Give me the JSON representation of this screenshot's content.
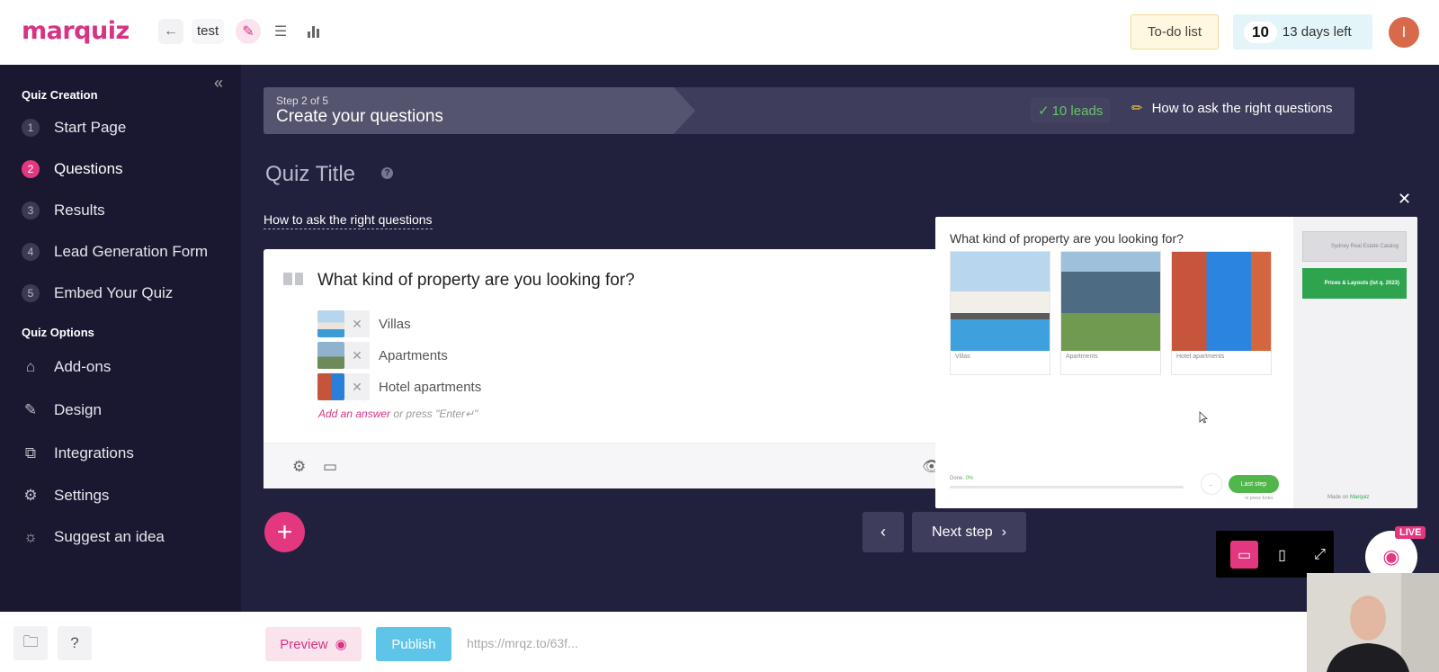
{
  "header": {
    "logo": "marquiz",
    "quiz_name": "test",
    "todo_label": "To-do list",
    "days_count": "10",
    "days_label": "13 days left",
    "avatar_initial": "I"
  },
  "sidebar": {
    "section_creation": "Quiz Creation",
    "steps": [
      {
        "num": "1",
        "label": "Start Page"
      },
      {
        "num": "2",
        "label": "Questions"
      },
      {
        "num": "3",
        "label": "Results"
      },
      {
        "num": "4",
        "label": "Lead Generation Form"
      },
      {
        "num": "5",
        "label": "Embed Your Quiz"
      }
    ],
    "section_options": "Quiz Options",
    "options": [
      {
        "label": "Add-ons",
        "icon": "tag-icon"
      },
      {
        "label": "Design",
        "icon": "brush-icon"
      },
      {
        "label": "Integrations",
        "icon": "plug-icon"
      },
      {
        "label": "Settings",
        "icon": "gear-icon"
      },
      {
        "label": "Suggest an idea",
        "icon": "lightbulb-icon"
      }
    ]
  },
  "stepbar": {
    "step_small": "Step 2 of 5",
    "step_title": "Create your questions",
    "leads": "10 leads",
    "howto": "How to ask the right questions"
  },
  "main": {
    "quiz_title": "Quiz Title",
    "howto_link": "How to ask the right questions",
    "question": "What kind of property are you looking for?",
    "answers": [
      {
        "label": "Villas"
      },
      {
        "label": "Apartments"
      },
      {
        "label": "Hotel apartments"
      }
    ],
    "add_answer_link": "Add an answer",
    "add_answer_hint": " or press \"Enter↵\"",
    "next_step": "Next step"
  },
  "preview": {
    "question": "What kind of property are you looking for?",
    "cards": [
      "Villas",
      "Apartments",
      "Hotel apartments"
    ],
    "done_label": "Done:",
    "done_value": "0%",
    "progress": 0,
    "last_step": "Last step",
    "enter_hint": "or press Enter",
    "side_item1": "Sydney Real Estate Catalog",
    "side_item2": "Prices & Layouts (Ist q. 2023)",
    "made_on": "Made on",
    "made_brand": "Marquiz",
    "live_badge": "LIVE"
  },
  "bottombar": {
    "preview_label": "Preview",
    "publish_label": "Publish",
    "url": "https://mrqz.to/63f..."
  },
  "colors": {
    "accent": "#e3387f",
    "sidebar_bg": "#191830",
    "main_bg": "#22213d",
    "publish": "#5ec5e8",
    "leads_green": "#64c36a"
  }
}
